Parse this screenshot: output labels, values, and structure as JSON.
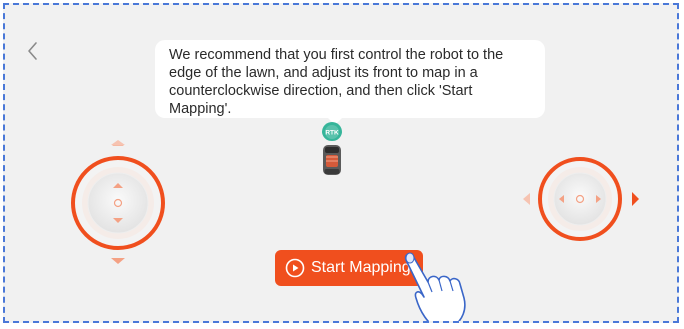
{
  "instruction_text": "We recommend that you first control the robot to the edge of the lawn, and adjust its front to map in a counterclockwise direction, and then click 'Start Mapping'.",
  "robot": {
    "badge_text": "RTK"
  },
  "start_button": {
    "label": "Start Mapping"
  },
  "icons": {
    "back": "chevron-left-icon",
    "play": "play-circle-icon",
    "hand": "tap-hand-icon"
  },
  "colors": {
    "accent": "#f04f1e",
    "accent_light": "#f4a184",
    "badge": "#36b59a",
    "background": "#f1f1f1",
    "frame_dash": "#4a78d8"
  }
}
